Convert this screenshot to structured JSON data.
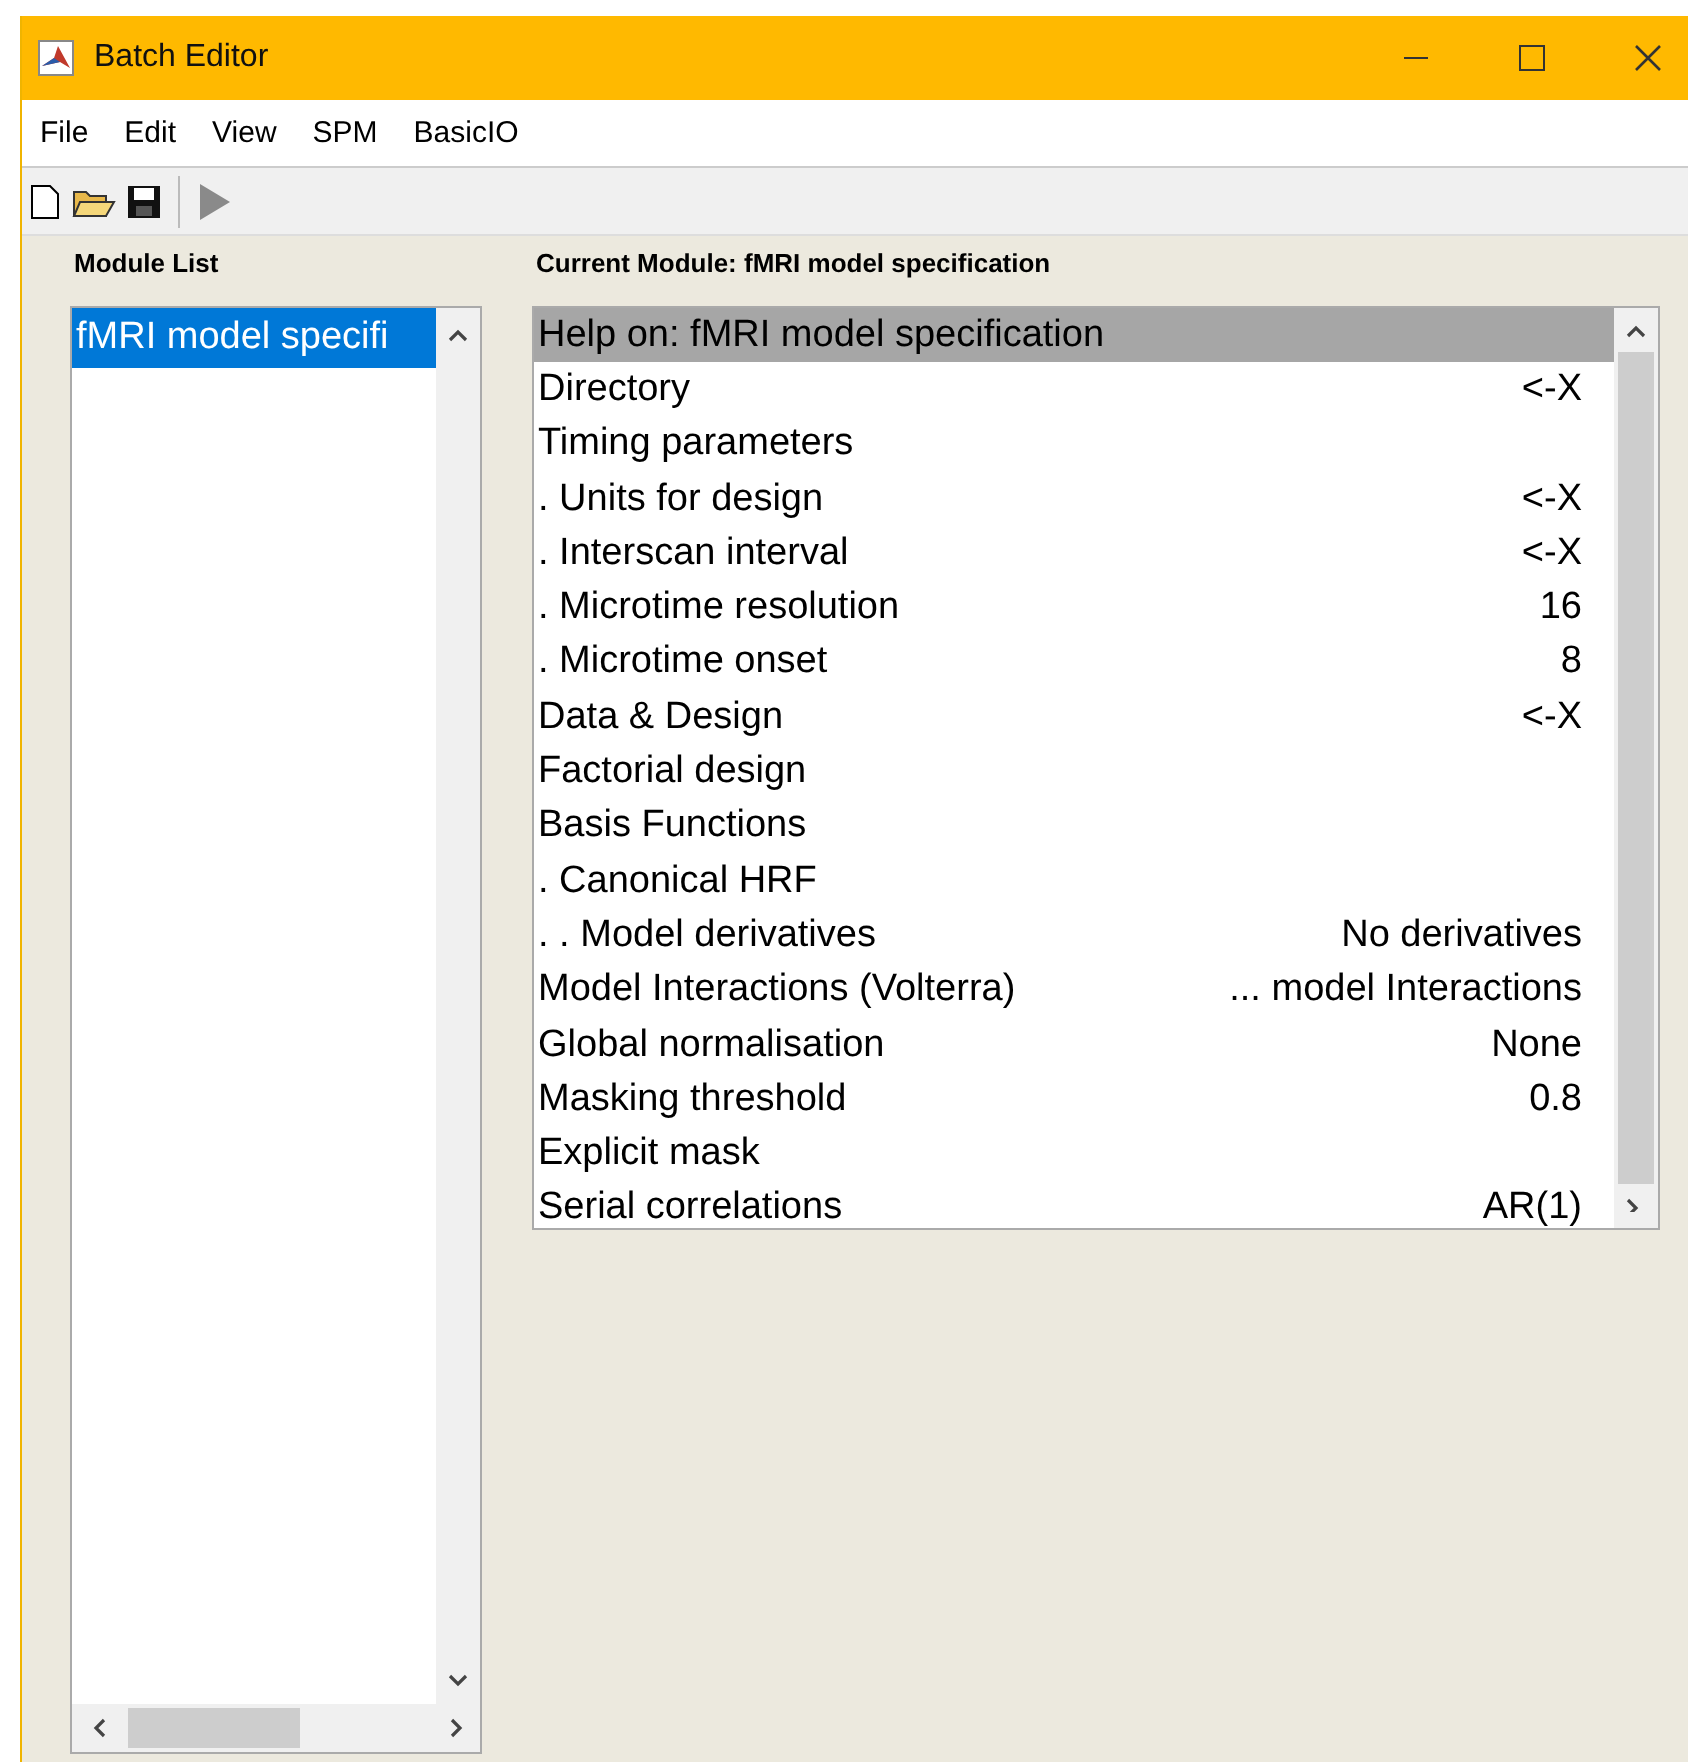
{
  "window": {
    "title": "Batch Editor"
  },
  "menu": [
    "File",
    "Edit",
    "View",
    "SPM",
    "BasicIO"
  ],
  "module_list": {
    "heading": "Module List",
    "items": [
      {
        "label": "fMRI model specifi",
        "selected": true
      }
    ]
  },
  "current_module": {
    "heading": "Current Module: fMRI model specification",
    "rows": [
      {
        "label": "Help on: fMRI model specification",
        "value": "",
        "selected": true
      },
      {
        "label": "Directory",
        "value": "<-X",
        "selected": false
      },
      {
        "label": "Timing parameters",
        "value": "",
        "selected": false
      },
      {
        "label": ". Units for design",
        "value": "<-X",
        "selected": false
      },
      {
        "label": ". Interscan interval",
        "value": "<-X",
        "selected": false
      },
      {
        "label": ". Microtime resolution",
        "value": "16",
        "selected": false
      },
      {
        "label": ". Microtime onset",
        "value": "8",
        "selected": false
      },
      {
        "label": "Data & Design",
        "value": "<-X",
        "selected": false
      },
      {
        "label": "Factorial design",
        "value": "",
        "selected": false
      },
      {
        "label": "Basis Functions",
        "value": "",
        "selected": false
      },
      {
        "label": ". Canonical HRF",
        "value": "",
        "selected": false
      },
      {
        "label": ". . Model derivatives",
        "value": "No derivatives",
        "selected": false
      },
      {
        "label": "Model Interactions (Volterra)",
        "value": "... model Interactions",
        "selected": false
      },
      {
        "label": "Global normalisation",
        "value": "None",
        "selected": false
      },
      {
        "label": "Masking threshold",
        "value": "0.8",
        "selected": false
      },
      {
        "label": "Explicit mask",
        "value": "",
        "selected": false
      },
      {
        "label": "Serial correlations",
        "value": "AR(1)",
        "selected": false
      }
    ]
  }
}
